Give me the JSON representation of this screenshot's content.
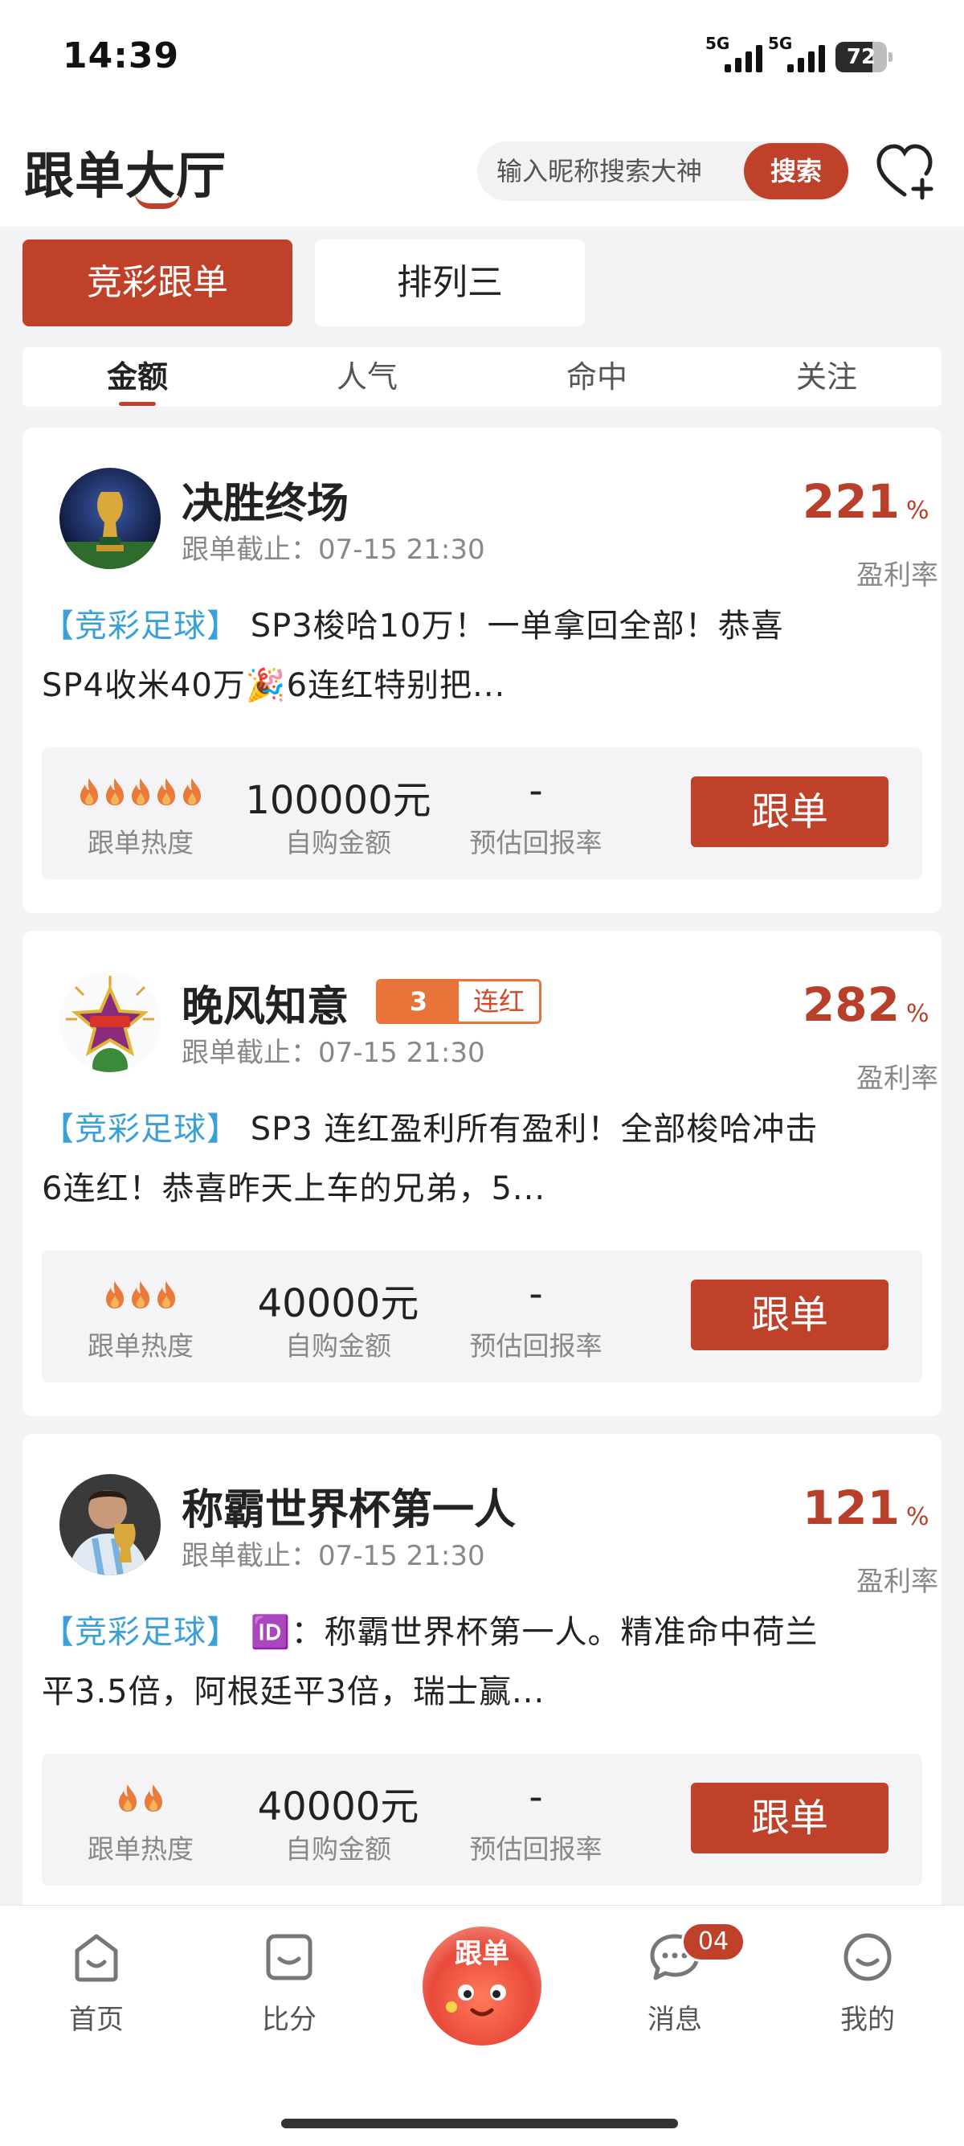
{
  "status_bar": {
    "time": "14:39",
    "network_1": "5G",
    "network_2": "5G",
    "battery": "72",
    "battery_level": 0.72
  },
  "header": {
    "title": "跟单大厅",
    "search_placeholder": "输入昵称搜索大神",
    "search_label": "搜索",
    "follow_icon": "heart-plus-icon"
  },
  "category_tabs": [
    "竞彩跟单",
    "排列三"
  ],
  "category_active": 0,
  "sort_tabs": [
    "金额",
    "人气",
    "命中",
    "关注"
  ],
  "sort_active": 0,
  "cards": [
    {
      "name": "决胜终场",
      "deadline": "跟单截止：07-15 21:30",
      "profit": "221",
      "profit_unit": "%",
      "profit_label": "盈利率",
      "streak_count": "",
      "streak_label": "",
      "tag": "【竞彩足球】",
      "desc_1": "  SP3梭哈10万！一单拿回全部！恭喜",
      "desc_2": "SP4收米40万🎉6连红特别把...",
      "heat": 5,
      "heat_label": "跟单热度",
      "amount": "100000元",
      "amount_label": "自购金额",
      "return": "-",
      "return_label": "预估回报率",
      "button": "跟单",
      "avatar_icon": "trophy-avatar"
    },
    {
      "name": "晚风知意",
      "deadline": "跟单截止：07-15 21:30",
      "profit": "282",
      "profit_unit": "%",
      "profit_label": "盈利率",
      "streak_count": "3",
      "streak_label": "连红",
      "tag": "【竞彩足球】",
      "desc_1": "  SP3 连红盈利所有盈利！全部梭哈冲击",
      "desc_2": "6连红！恭喜昨天上车的兄弟，5...",
      "heat": 3,
      "heat_label": "跟单热度",
      "amount": "40000元",
      "amount_label": "自购金额",
      "return": "-",
      "return_label": "预估回报率",
      "button": "跟单",
      "avatar_icon": "star-badge-avatar"
    },
    {
      "name": "称霸世界杯第一人",
      "deadline": "跟单截止：07-15 21:30",
      "profit": "121",
      "profit_unit": "%",
      "profit_label": "盈利率",
      "streak_count": "",
      "streak_label": "",
      "tag": "【竞彩足球】",
      "desc_1": "  🆔：称霸世界杯第一人。精准命中荷兰",
      "desc_2": "平3.5倍，阿根廷平3倍，瑞士赢...",
      "heat": 2,
      "heat_label": "跟单热度",
      "amount": "40000元",
      "amount_label": "自购金额",
      "return": "-",
      "return_label": "预估回报率",
      "button": "跟单",
      "avatar_icon": "player-avatar"
    }
  ],
  "bottom_nav": {
    "items": [
      "首页",
      "比分",
      "跟单",
      "消息",
      "我的"
    ],
    "message_badge": "04"
  },
  "colors": {
    "brand": "#c0412a",
    "tag": "#3aa0d8",
    "streak": "#e8743a"
  }
}
